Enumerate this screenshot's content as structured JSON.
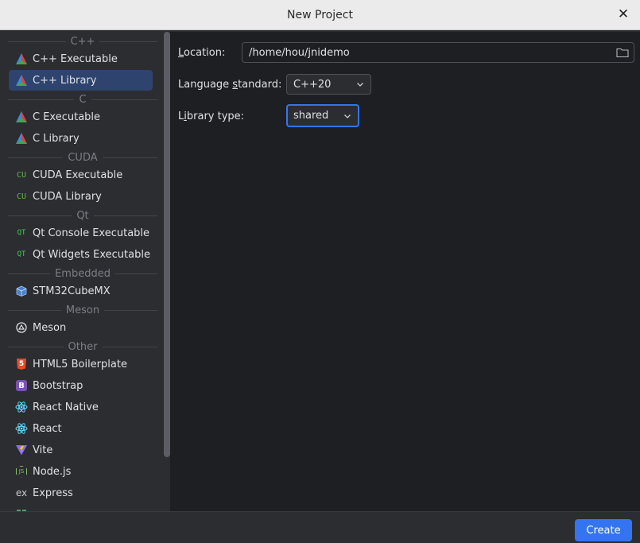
{
  "window": {
    "title": "New Project",
    "close_glyph": "✕"
  },
  "sidebar": {
    "groups": [
      {
        "label": "C++"
      },
      {
        "label": "C"
      },
      {
        "label": "CUDA"
      },
      {
        "label": "Qt"
      },
      {
        "label": "Embedded"
      },
      {
        "label": "Meson"
      },
      {
        "label": "Other"
      }
    ],
    "items": [
      {
        "label": "C++ Executable",
        "icon": "cmake-icon"
      },
      {
        "label": "C++ Library",
        "icon": "cmake-icon",
        "selected": true
      },
      {
        "label": "C Executable",
        "icon": "cmake-icon"
      },
      {
        "label": "C Library",
        "icon": "cmake-icon"
      },
      {
        "label": "CUDA Executable",
        "icon": "cuda-icon",
        "glyph": "CU"
      },
      {
        "label": "CUDA Library",
        "icon": "cuda-icon",
        "glyph": "CU"
      },
      {
        "label": "Qt Console Executable",
        "icon": "qt-icon",
        "glyph": "QT"
      },
      {
        "label": "Qt Widgets Executable",
        "icon": "qt-icon",
        "glyph": "QT"
      },
      {
        "label": "STM32CubeMX",
        "icon": "cube-icon"
      },
      {
        "label": "Meson",
        "icon": "meson-icon"
      },
      {
        "label": "HTML5 Boilerplate",
        "icon": "html5-icon",
        "glyph": "5"
      },
      {
        "label": "Bootstrap",
        "icon": "bootstrap-icon",
        "glyph": "B"
      },
      {
        "label": "React Native",
        "icon": "react-icon"
      },
      {
        "label": "React",
        "icon": "react-icon"
      },
      {
        "label": "Vite",
        "icon": "vite-icon"
      },
      {
        "label": "Node.js",
        "icon": "nodejs-icon",
        "glyph": "JS"
      },
      {
        "label": "Express",
        "icon": "express-icon",
        "glyph": "ex"
      }
    ]
  },
  "form": {
    "location": {
      "label_pre": "",
      "label_mnemonic": "L",
      "label_post": "ocation:",
      "value": "/home/hou/jnidemo"
    },
    "language_standard": {
      "label_pre": "Language ",
      "label_mnemonic": "s",
      "label_post": "tandard:",
      "value": "C++20"
    },
    "library_type": {
      "label_pre": "L",
      "label_mnemonic": "i",
      "label_post": "brary type:",
      "value": "shared"
    }
  },
  "footer": {
    "create_label": "Create"
  },
  "colors": {
    "accent": "#3574f0",
    "selected_bg": "#2e436e",
    "panel_bg": "#2b2d30",
    "content_bg": "#1e1f22"
  }
}
